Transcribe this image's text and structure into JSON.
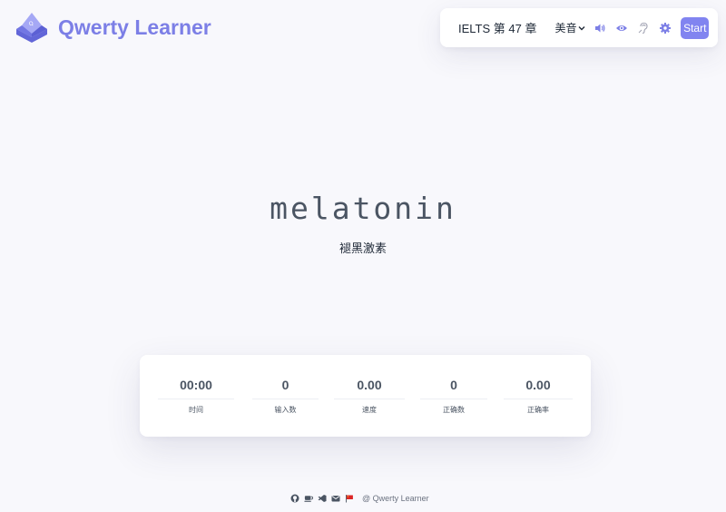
{
  "app": {
    "name": "Qwerty Learner",
    "brand_color": "#7c7fe6"
  },
  "toolbar": {
    "dictionary_label": "IELTS 第 47 章",
    "accent_label": "美音",
    "icons": [
      "speaker-icon",
      "eye-icon",
      "hearing-icon",
      "gear-icon"
    ],
    "start_label": "Start",
    "start_color": "#8184f0"
  },
  "word": {
    "text": "melatonin",
    "translation": "褪黑激素"
  },
  "stats": [
    {
      "value": "00:00",
      "label": "时间"
    },
    {
      "value": "0",
      "label": "输入数"
    },
    {
      "value": "0.00",
      "label": "速度"
    },
    {
      "value": "0",
      "label": "正确数"
    },
    {
      "value": "0.00",
      "label": "正确率"
    }
  ],
  "footer": {
    "icons": [
      "github-icon",
      "coffee-icon",
      "vscode-icon",
      "mail-icon",
      "flag-icon"
    ],
    "text": "@ Qwerty Learner"
  }
}
